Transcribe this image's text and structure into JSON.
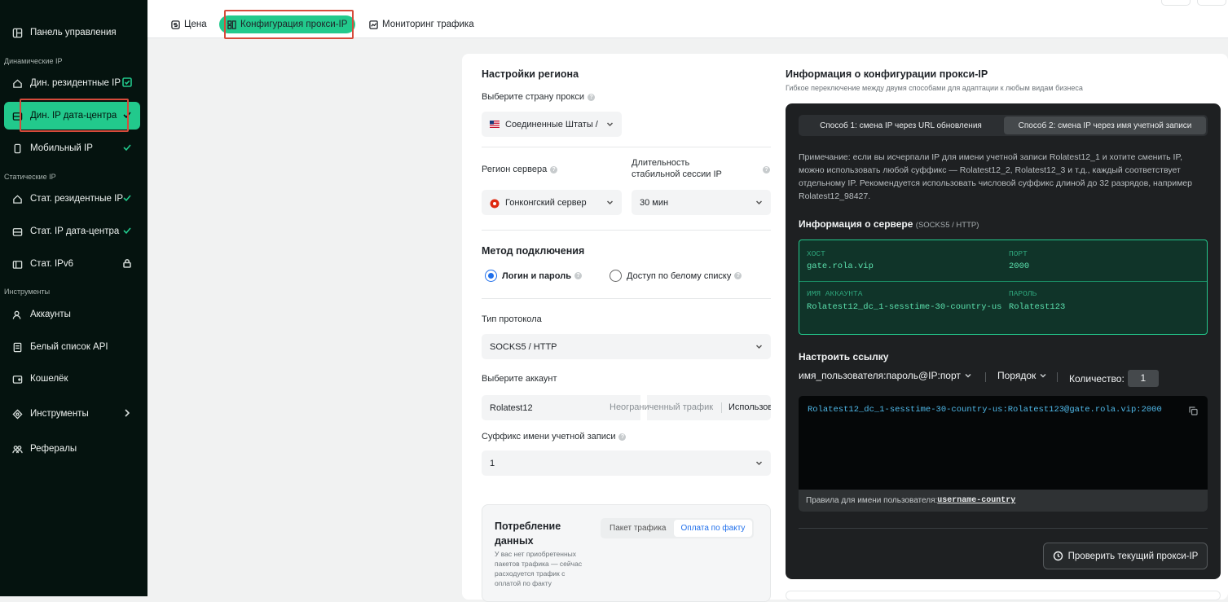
{
  "sidebar": {
    "items": {
      "dashboard": "Панель управления",
      "dyn_residential": "Дин. резидентные IP",
      "dyn_datacenter": "Дин. IP дата-центра",
      "mobile": "Мобильный IP",
      "static_residential": "Стат. резидентные IP",
      "static_datacenter": "Стат. IP дата-центра",
      "static_ipv6": "Стат. IPv6",
      "accounts": "Аккаунты",
      "api_whitelist": "Белый список API",
      "wallet": "Кошелёк",
      "tools": "Инструменты",
      "referrals": "Рефералы"
    },
    "sections": {
      "dynamic": "Динамические IP",
      "static": "Статические IP",
      "tools": "Инструменты"
    }
  },
  "tabs": {
    "price": "Цена",
    "proxy_config": "Конфигурация прокси-IP",
    "traffic": "Мониторинг трафика"
  },
  "form": {
    "region_title": "Настройки региона",
    "country_label": "Выберите страну прокси",
    "country_value": "Соединенные Штаты /",
    "server_label": "Регион сервера",
    "server_value": "Гонконгский сервер",
    "session_label": "Длительность стабильной сессии IP",
    "session_value": "30 мин",
    "method_title": "Метод подключения",
    "method_login": "Логин и пароль",
    "method_whitelist": "Доступ по белому списку",
    "protocol_label": "Тип протокола",
    "protocol_value": "SOCKS5 / HTTP",
    "account_label": "Выберите аккаунт",
    "account_value": "Rolatest12",
    "account_traffic": "Неограниченный трафик",
    "account_used": "Использован",
    "suffix_label": "Суффикс имени учетной записи",
    "suffix_value": "1",
    "consumption_title": "Потребление данных",
    "consumption_seg_package": "Пакет трафика",
    "consumption_seg_payg": "Оплата по факту",
    "consumption_note": "У вас нет приобретенных пакетов трафика — сейчас расходуется трафик с оплатой по факту"
  },
  "info": {
    "title": "Информация о конфигурации прокси-IP",
    "subtitle": "Гибкое переключение между двумя способами для адаптации к любым видам бизнеса",
    "tab1": "Способ 1: смена IP через URL обновления",
    "tab2": "Способ 2: смена IP через имя учетной записи",
    "note": "Примечание: если вы исчерпали IP для имени учетной записи Rolatest12_1 и хотите сменить IP, можно использовать любой суффикс — Rolatest12_2, Rolatest12_3 и т.д., каждый соответствует отдельному IP. Рекомендуется использовать числовой суффикс длиной до 32 разрядов, например Rolatest12_98427.",
    "server_title": "Информация о сервере",
    "server_protocol": "(SOCKS5 / HTTP)",
    "host_label": "ХОСТ",
    "host_value": "gate.rola.vip",
    "port_label": "ПОРТ",
    "port_value": "2000",
    "account_label": "ИМЯ АККАУНТА",
    "account_value": "Rolatest12_dc_1-sesstime-30-country-us",
    "password_label": "ПАРОЛЬ",
    "password_value": "Rolatest123",
    "link_title": "Настроить ссылку",
    "format_value": "имя_пользователя:пароль@IP:порт",
    "order_value": "Порядок",
    "count_label": "Количество:",
    "count_value": "1",
    "link_value": "Rolatest12_dc_1-sesstime-30-country-us:Rolatest123@gate.rola.vip:2000",
    "rules_label": "Правила для имени пользователя:",
    "rules_value": "username-country",
    "check_button": "Проверить текущий прокси-IP"
  },
  "colors": {
    "accent": "#22c98c",
    "sidebar_bg": "#05130f",
    "highlight": "#d64b3b",
    "link_text": "#4fb8e8"
  }
}
